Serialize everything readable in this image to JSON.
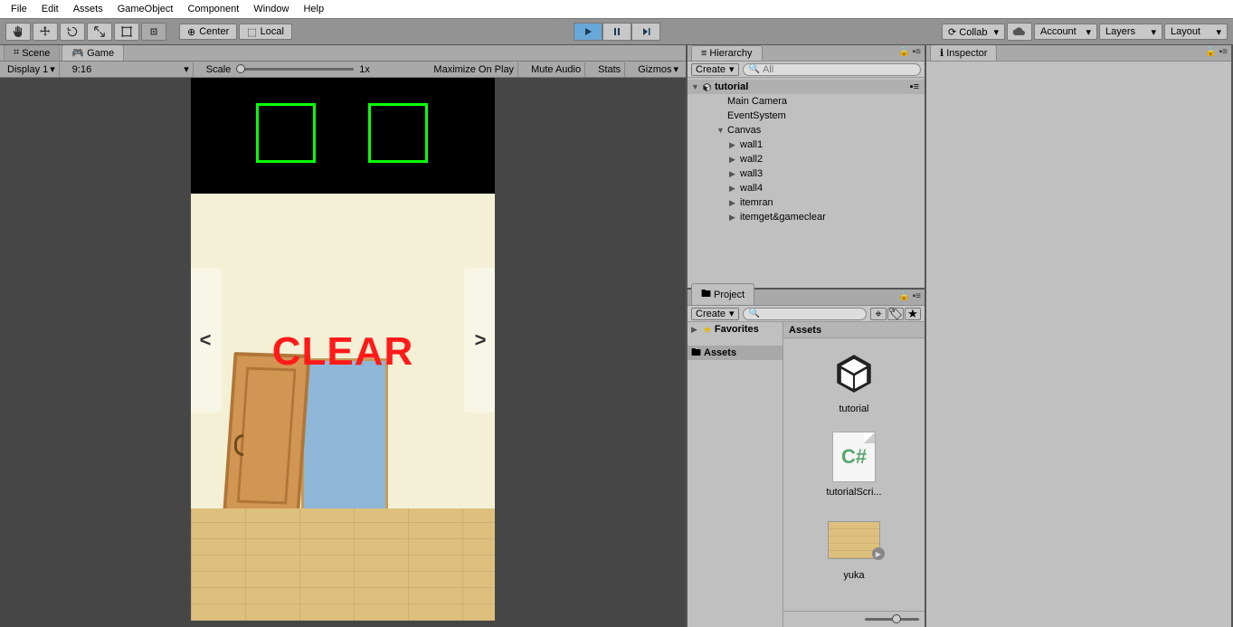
{
  "menubar": [
    "File",
    "Edit",
    "Assets",
    "GameObject",
    "Component",
    "Window",
    "Help"
  ],
  "toolbar": {
    "center": "Center",
    "local": "Local",
    "collab": "Collab",
    "account": "Account",
    "layers": "Layers",
    "layout": "Layout"
  },
  "game_panel": {
    "tab_scene": "Scene",
    "tab_game": "Game",
    "display": "Display 1",
    "aspect": "9:16",
    "scale_label": "Scale",
    "scale_value": "1x",
    "maximize": "Maximize On Play",
    "mute": "Mute Audio",
    "stats": "Stats",
    "gizmos": "Gizmos",
    "clear_text": "CLEAR",
    "nav_left": "<",
    "nav_right": ">"
  },
  "hierarchy": {
    "title": "Hierarchy",
    "create": "Create",
    "search_placeholder": "All",
    "scene": "tutorial",
    "items": [
      {
        "label": "Main Camera",
        "indent": 2,
        "arrow": ""
      },
      {
        "label": "EventSystem",
        "indent": 2,
        "arrow": ""
      },
      {
        "label": "Canvas",
        "indent": 2,
        "arrow": "▼"
      },
      {
        "label": "wall1",
        "indent": 3,
        "arrow": "▶"
      },
      {
        "label": "wall2",
        "indent": 3,
        "arrow": "▶"
      },
      {
        "label": "wall3",
        "indent": 3,
        "arrow": "▶"
      },
      {
        "label": "wall4",
        "indent": 3,
        "arrow": "▶"
      },
      {
        "label": "itemran",
        "indent": 3,
        "arrow": "▶"
      },
      {
        "label": "itemget&gameclear",
        "indent": 3,
        "arrow": "▶"
      }
    ]
  },
  "project": {
    "title": "Project",
    "create": "Create",
    "favorites": "Favorites",
    "assets": "Assets",
    "breadcrumb": "Assets",
    "items": [
      {
        "name": "tutorial",
        "type": "scene"
      },
      {
        "name": "tutorialScri...",
        "type": "cs"
      },
      {
        "name": "yuka",
        "type": "texture"
      }
    ]
  },
  "inspector": {
    "title": "Inspector"
  }
}
